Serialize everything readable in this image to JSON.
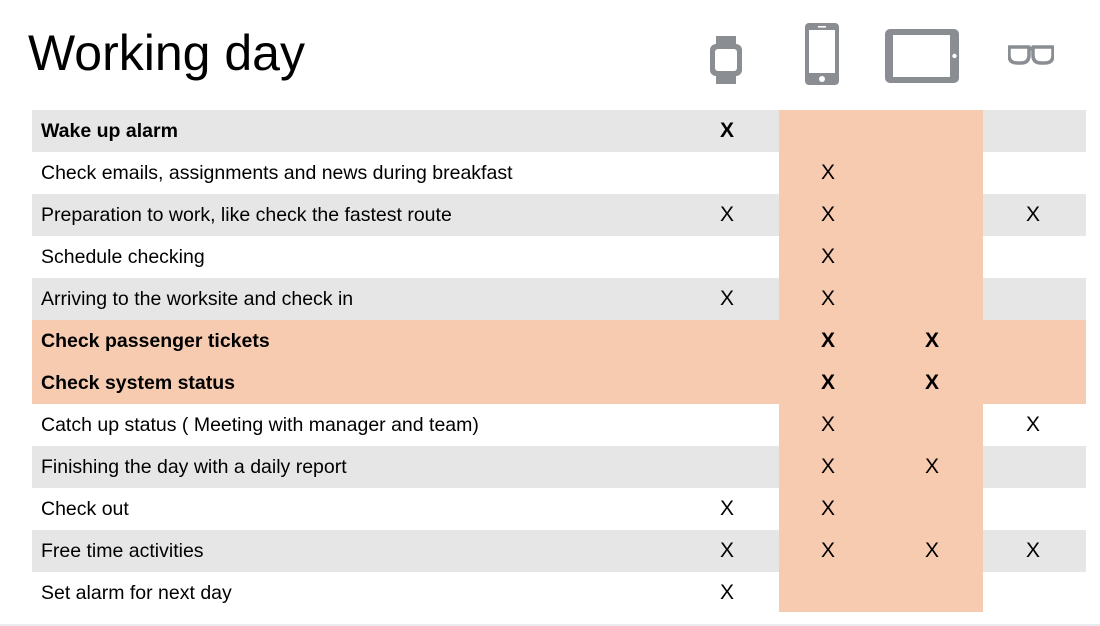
{
  "title": "Working day",
  "devices": [
    {
      "id": "watch",
      "icon": "smartwatch-icon"
    },
    {
      "id": "phone",
      "icon": "smartphone-icon"
    },
    {
      "id": "tablet",
      "icon": "tablet-icon"
    },
    {
      "id": "glasses",
      "icon": "smart-glasses-icon"
    }
  ],
  "mark_symbol": "X",
  "colors": {
    "row_shade": "#e6e6e6",
    "highlight": "#f7cbb0",
    "icon_gray": "#8a8d91"
  },
  "rows": [
    {
      "label": "Wake up alarm",
      "bold": true,
      "shade": true,
      "highlight": false,
      "watch": "X",
      "phone": "",
      "tablet": "",
      "glasses": ""
    },
    {
      "label": "Check emails, assignments and news during breakfast",
      "bold": false,
      "shade": false,
      "highlight": false,
      "watch": "",
      "phone": "X",
      "tablet": "",
      "glasses": ""
    },
    {
      "label": "Preparation to work, like check the fastest route",
      "bold": false,
      "shade": true,
      "highlight": false,
      "watch": "X",
      "phone": "X",
      "tablet": "",
      "glasses": "X"
    },
    {
      "label": "Schedule checking",
      "bold": false,
      "shade": false,
      "highlight": false,
      "watch": "",
      "phone": "X",
      "tablet": "",
      "glasses": ""
    },
    {
      "label": "Arriving to the worksite and check in",
      "bold": false,
      "shade": true,
      "highlight": false,
      "watch": "X",
      "phone": "X",
      "tablet": "",
      "glasses": ""
    },
    {
      "label": "Check passenger tickets",
      "bold": true,
      "shade": false,
      "highlight": true,
      "watch": "",
      "phone": "X",
      "tablet": "X",
      "glasses": ""
    },
    {
      "label": "Check system status",
      "bold": true,
      "shade": false,
      "highlight": true,
      "watch": "",
      "phone": "X",
      "tablet": "X",
      "glasses": ""
    },
    {
      "label": "Catch up status ( Meeting with manager and team)",
      "bold": false,
      "shade": false,
      "highlight": false,
      "watch": "",
      "phone": "X",
      "tablet": "",
      "glasses": "X"
    },
    {
      "label": "Finishing the day with a daily report",
      "bold": false,
      "shade": true,
      "highlight": false,
      "watch": "",
      "phone": "X",
      "tablet": "X",
      "glasses": ""
    },
    {
      "label": "Check out",
      "bold": false,
      "shade": false,
      "highlight": false,
      "watch": "X",
      "phone": "X",
      "tablet": "",
      "glasses": ""
    },
    {
      "label": "Free time activities",
      "bold": false,
      "shade": true,
      "highlight": false,
      "watch": "X",
      "phone": "X",
      "tablet": "X",
      "glasses": "X"
    },
    {
      "label": "Set alarm for next day",
      "bold": false,
      "shade": false,
      "highlight": false,
      "watch": "X",
      "phone": "",
      "tablet": "",
      "glasses": ""
    }
  ]
}
